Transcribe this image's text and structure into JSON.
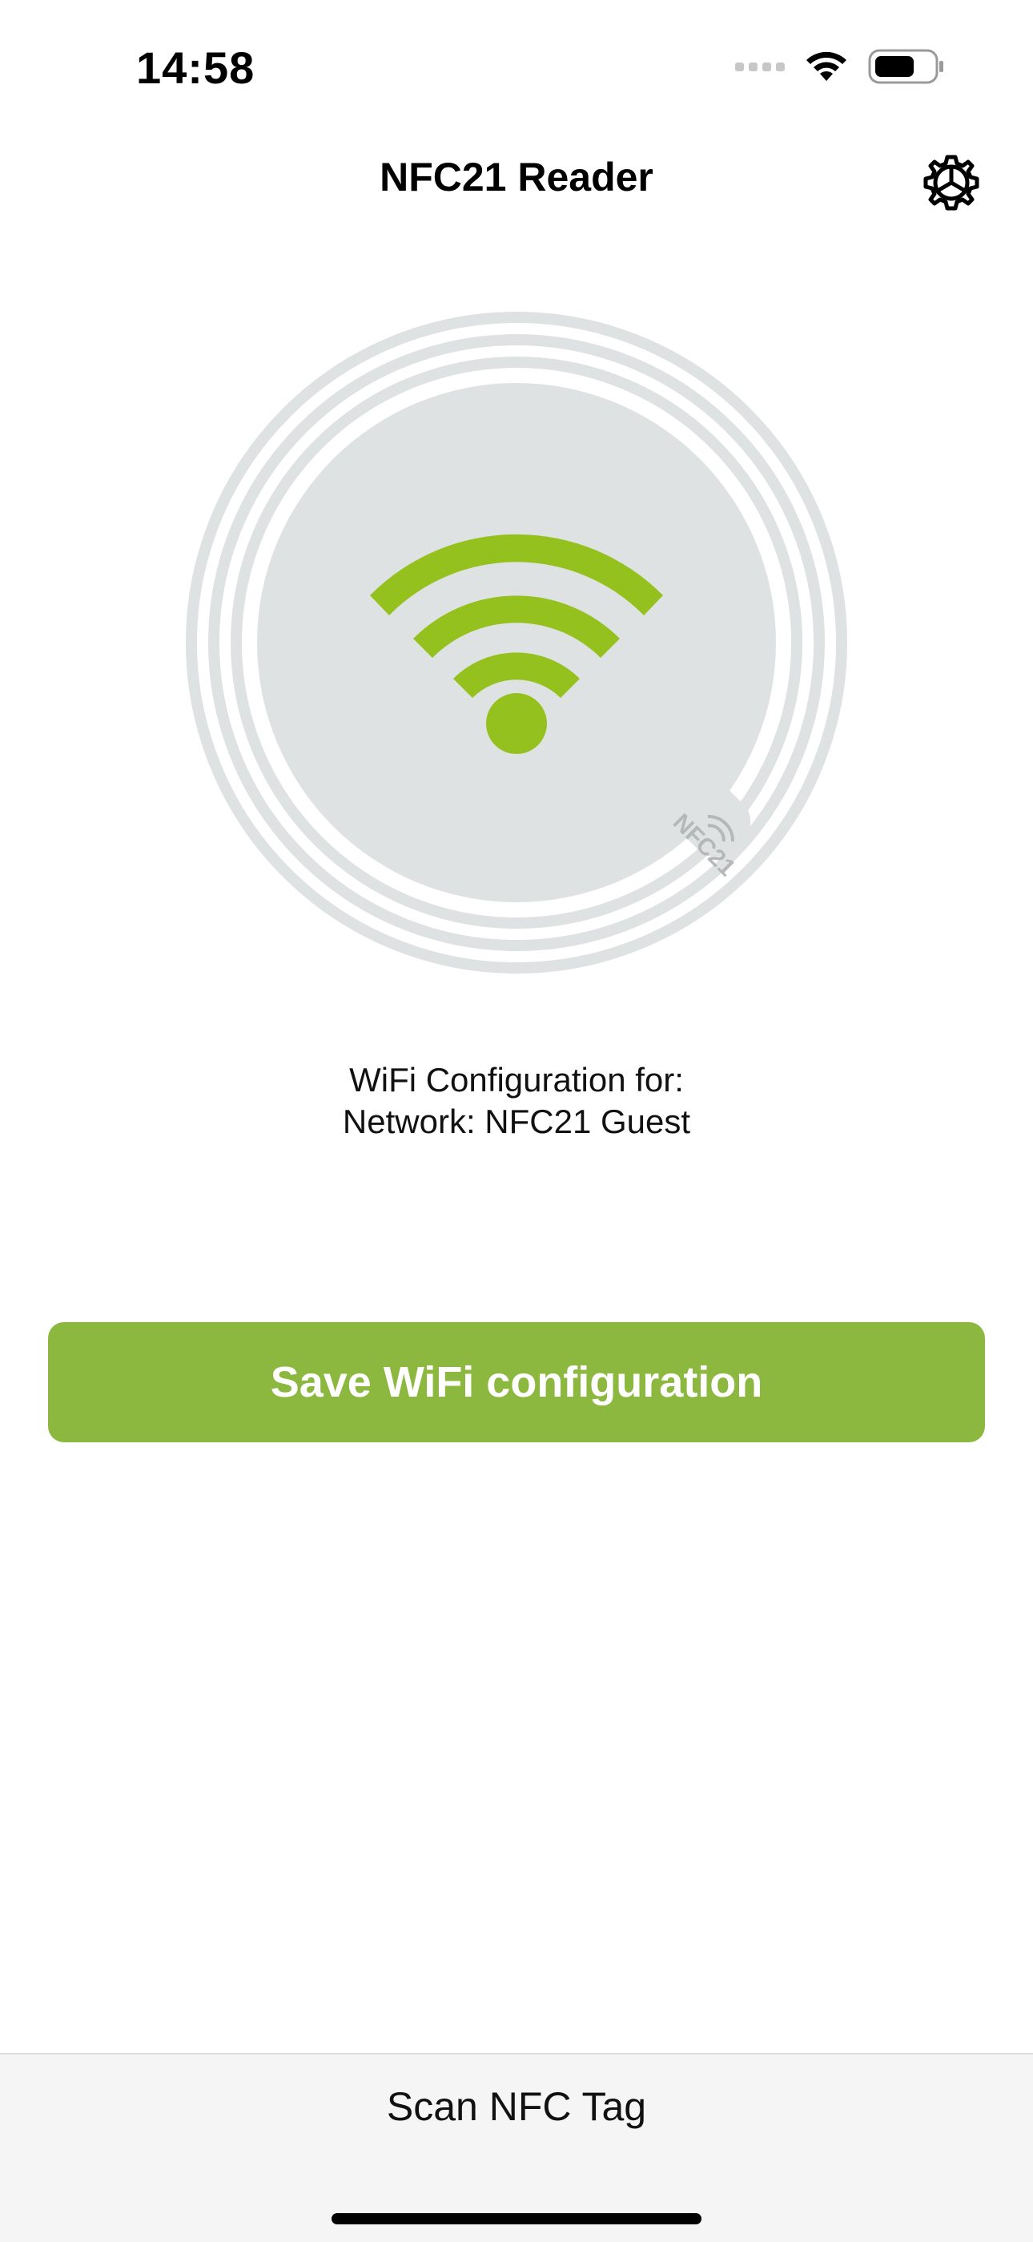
{
  "status_bar": {
    "time": "14:58"
  },
  "nav": {
    "title": "NFC21 Reader",
    "settings_icon": "gear-icon"
  },
  "tag": {
    "badge_text": "NFC21",
    "icon": "wifi-icon",
    "colors": {
      "disc": "#dfe2e2",
      "rings": "#dfe2e2",
      "wifi": "#95c11f"
    }
  },
  "info": {
    "line1": "WiFi Configuration for:",
    "line2": "Network: NFC21 Guest"
  },
  "actions": {
    "save_label": "Save WiFi configuration",
    "save_color": "#8cb83f"
  },
  "toolbar": {
    "scan_label": "Scan NFC Tag"
  }
}
